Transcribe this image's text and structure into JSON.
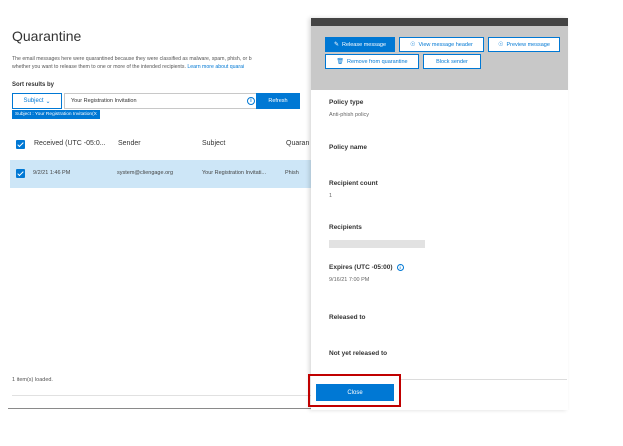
{
  "page": {
    "title": "Quarantine",
    "description_line1": "The email messages here were quarantined because they were classified as malware, spam, phish, or b",
    "description_line2_text": "whether you want to release them to one or more of the intended recipients.",
    "description_line2_link": "Learn more about quarai"
  },
  "sort": {
    "label": "Sort results by",
    "subject_dropdown": "Subject",
    "search_value": "Your Registration Invitation",
    "refresh_label": "Refresh",
    "filter_chip": "Subject : Your Registration Invitation(X"
  },
  "table": {
    "headers": [
      "Received (UTC -05:0...",
      "Sender",
      "Subject",
      "Quaran"
    ],
    "rows": [
      {
        "received": "9/2/21 1:46 PM",
        "sender": "system@cliengage.org",
        "subject": "Your Registration Invitati...",
        "quarantine_reason": "Phish"
      }
    ],
    "status": "1 item(s) loaded."
  },
  "panel": {
    "toolbar": {
      "release": "Release message",
      "view_header": "View message header",
      "preview": "Preview message",
      "remove": "Remove from quarantine",
      "block": "Block sender"
    },
    "fields": {
      "policy_type_label": "Policy type",
      "policy_type_value": "Anti-phish policy",
      "policy_name_label": "Policy name",
      "recipient_count_label": "Recipient count",
      "recipient_count_value": "1",
      "recipients_label": "Recipients",
      "expires_label": "Expires (UTC -05:00)",
      "expires_value": "9/16/21 7:00 PM",
      "released_to_label": "Released to",
      "not_released_label": "Not yet released to"
    },
    "close_label": "Close"
  },
  "colors": {
    "accent": "#0078d4",
    "selected_row": "#cde6f7",
    "highlight_border": "#c00000",
    "toolbar_bg": "#c8c8c8"
  }
}
